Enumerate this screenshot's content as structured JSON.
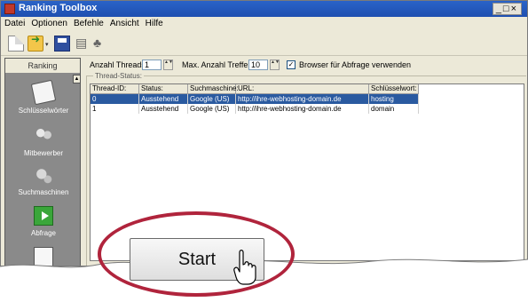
{
  "window": {
    "title": "Ranking Toolbox",
    "controls": "_□×"
  },
  "menu": [
    "Datei",
    "Optionen",
    "Befehle",
    "Ansicht",
    "Hilfe"
  ],
  "toolbar": {
    "dropdown_arrow": "▾",
    "tool1": "▤",
    "tool2": "♣"
  },
  "sidebar": {
    "header": "Ranking",
    "scroll_glyph": "▲",
    "items": [
      {
        "label": "Schlüsselwörter",
        "icon": "keys-icon"
      },
      {
        "label": "Mitbewerber",
        "icon": "people-icon"
      },
      {
        "label": "Suchmaschinen",
        "icon": "gears-icon"
      },
      {
        "label": "Abfrage",
        "icon": "play-icon"
      },
      {
        "label": "",
        "icon": "document-icon"
      }
    ]
  },
  "controls": {
    "threads_label": "Anzahl Threads:",
    "threads_value": "1",
    "max_hits_label": "Max. Anzahl Treffer:",
    "max_hits_value": "10",
    "browser_checkbox_label": "Browser für Abfrage verwenden",
    "browser_checkbox_checked": true,
    "spin_glyph": "▲▼"
  },
  "thread_status": {
    "group_title": "Thread-Status:",
    "columns": [
      "Thread-ID:",
      "Status:",
      "Suchmaschine:",
      "URL:",
      "Schlüsselwort:"
    ],
    "rows": [
      [
        "0",
        "Ausstehend",
        "Google (US)",
        "http://ihre-webhosting-domain.de",
        "hosting"
      ],
      [
        "1",
        "Ausstehend",
        "Google (US)",
        "http://ihre-webhosting-domain.de",
        "domain"
      ]
    ],
    "selected_row": 0
  },
  "start_button": {
    "label": "Start"
  },
  "colors": {
    "accent_oval": "#b0243c",
    "selection": "#2a5aa0",
    "titlebar": "#2a63c8"
  }
}
